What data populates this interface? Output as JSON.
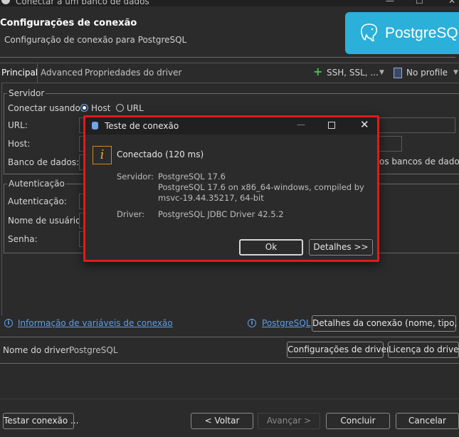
{
  "window": {
    "title": "Conectar a um banco de dados"
  },
  "header": {
    "title": "Configurações de conexão",
    "subtitle": "Configuração de conexão para PostgreSQL",
    "logo_text": "PostgreSQL"
  },
  "tabs": [
    {
      "label": "Principal"
    },
    {
      "label": "Advanced"
    },
    {
      "label": "Propriedades do driver"
    }
  ],
  "toolbar": {
    "ssh_label": "SSH, SSL, ...",
    "profile_label": "No profile"
  },
  "server": {
    "legend": "Servidor",
    "connect_using_label": "Conectar usando:",
    "options": [
      {
        "label": "Host",
        "selected": true
      },
      {
        "label": "URL",
        "selected": false
      }
    ],
    "url_label": "URL:",
    "host_label": "Host:",
    "database_label": "Banco de dados:",
    "show_all_databases": "os bancos de dados"
  },
  "auth": {
    "legend": "Autenticação",
    "auth_label": "Autenticação:",
    "username_label": "Nome de usuário:",
    "password_label": "Senha:"
  },
  "links": {
    "variables_info": "Informação de variáveis de conexão",
    "postgresql": "PostgreSQL",
    "connection_details_button": "Detalhes da conexão (nome, tipo, ...)"
  },
  "driver": {
    "label": "Nome do driver:",
    "value": "PostgreSQL",
    "settings_button": "Configurações de driver",
    "license_button": "Licença do driver"
  },
  "footer": {
    "test_button": "Testar conexão ...",
    "back_button": "< Voltar",
    "next_button": "Avançar >",
    "finish_button": "Concluir",
    "cancel_button": "Cancelar"
  },
  "dialog": {
    "title": "Teste de conexão",
    "status": "Conectado (120 ms)",
    "server_label": "Servidor:",
    "server_line1": "PostgreSQL 17.6",
    "server_line2": "PostgreSQL 17.6 on x86_64-windows, compiled by",
    "server_line3": "msvc-19.44.35217, 64-bit",
    "driver_label": "Driver:",
    "driver_value": "PostgreSQL JDBC Driver 42.5.2",
    "ok_button": "Ok",
    "details_button": "Detalhes >>"
  },
  "colors": {
    "accent": "#5d9ee8",
    "logo_bg": "#2ab0d9",
    "highlight_border": "#e01b1b",
    "background": "#2b2b2b"
  }
}
